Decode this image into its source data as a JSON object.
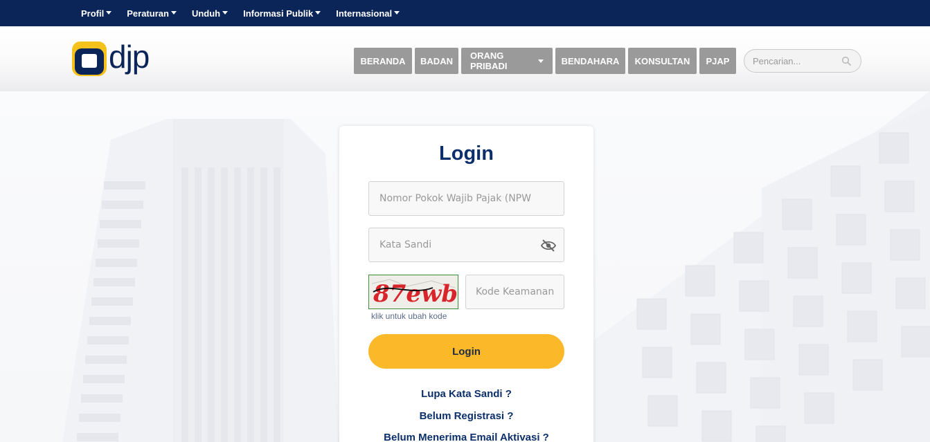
{
  "topbar": {
    "menu": [
      {
        "label": "Profil"
      },
      {
        "label": "Peraturan"
      },
      {
        "label": "Unduh"
      },
      {
        "label": "Informasi Publik"
      },
      {
        "label": "Internasional"
      }
    ]
  },
  "header": {
    "logo_text": "djp",
    "nav": [
      {
        "label": "BERANDA"
      },
      {
        "label": "BADAN"
      },
      {
        "label": "ORANG PRIBADI"
      },
      {
        "label": "BENDAHARA"
      },
      {
        "label": "KONSULTAN"
      },
      {
        "label": "PJAP"
      }
    ],
    "search_placeholder": "Pencarian..."
  },
  "login": {
    "title": "Login",
    "npwp_placeholder": "Nomor Pokok Wajib Pajak (NPWP)",
    "password_placeholder": "Kata Sandi",
    "captcha_text": "87ewb",
    "captcha_placeholder": "Kode Keamanan",
    "captcha_hint": "klik untuk ubah kode",
    "button_label": "Login",
    "forgot_link": "Lupa Kata Sandi ?",
    "register_link": "Belum Registrasi ?",
    "activation_link": "Belum Menerima Email Aktivasi ?"
  },
  "colors": {
    "navy": "#0b2559",
    "button_yellow": "#fbb829",
    "nav_gray": "#9a9a9a"
  }
}
